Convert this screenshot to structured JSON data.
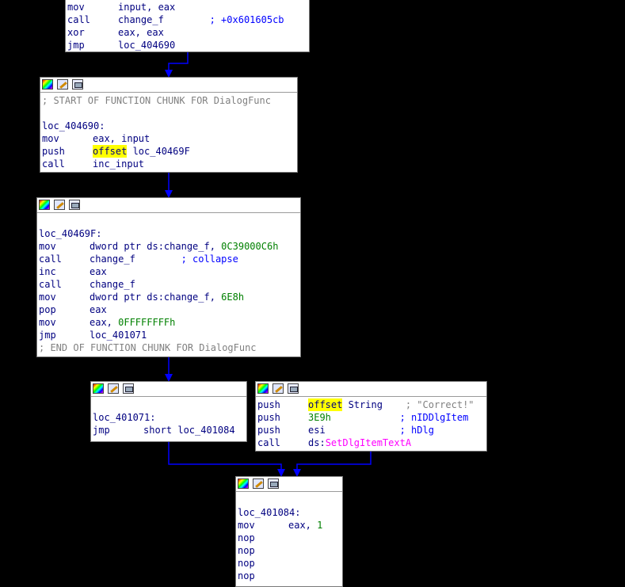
{
  "nodes": {
    "n1": {
      "lines": [
        {
          "m": "mov",
          "a": [
            {
              "t": "input, eax",
              "c": "op"
            }
          ]
        },
        {
          "m": "call",
          "a": [
            {
              "t": "change_f",
              "c": "op"
            },
            {
              "t": "        ; +0x601605cb",
              "c": "cm"
            }
          ]
        },
        {
          "m": "xor",
          "a": [
            {
              "t": "eax, eax",
              "c": "op"
            }
          ]
        },
        {
          "m": "jmp",
          "a": [
            {
              "t": "loc_404690",
              "c": "op"
            }
          ]
        }
      ]
    },
    "n2": {
      "lines": [
        {
          "raw": [
            {
              "t": "; START OF FUNCTION CHUNK FOR DialogFunc",
              "c": "gr"
            }
          ]
        },
        {
          "raw": []
        },
        {
          "raw": [
            {
              "t": "loc_404690:",
              "c": "lbl"
            }
          ]
        },
        {
          "m": "mov",
          "a": [
            {
              "t": "eax, input",
              "c": "op"
            }
          ]
        },
        {
          "m": "push",
          "a": [
            {
              "t": "offset",
              "c": "hl"
            },
            {
              "t": " loc_40469F",
              "c": "op"
            }
          ]
        },
        {
          "m": "call",
          "a": [
            {
              "t": "inc_input",
              "c": "op"
            }
          ]
        }
      ]
    },
    "n3": {
      "lines": [
        {
          "raw": []
        },
        {
          "raw": [
            {
              "t": "loc_40469F:",
              "c": "lbl"
            }
          ]
        },
        {
          "m": "mov",
          "a": [
            {
              "t": "dword ptr ds:change_f, ",
              "c": "op"
            },
            {
              "t": "0C39000C6h",
              "c": "num"
            }
          ]
        },
        {
          "m": "call",
          "a": [
            {
              "t": "change_f",
              "c": "op"
            },
            {
              "t": "        ; collapse",
              "c": "cm"
            }
          ]
        },
        {
          "m": "inc",
          "a": [
            {
              "t": "eax",
              "c": "op"
            }
          ]
        },
        {
          "m": "call",
          "a": [
            {
              "t": "change_f",
              "c": "op"
            }
          ]
        },
        {
          "m": "mov",
          "a": [
            {
              "t": "dword ptr ds:change_f, ",
              "c": "op"
            },
            {
              "t": "6E8h",
              "c": "num"
            }
          ]
        },
        {
          "m": "pop",
          "a": [
            {
              "t": "eax",
              "c": "op"
            }
          ]
        },
        {
          "m": "mov",
          "a": [
            {
              "t": "eax, ",
              "c": "op"
            },
            {
              "t": "0FFFFFFFFh",
              "c": "num"
            }
          ]
        },
        {
          "m": "jmp",
          "a": [
            {
              "t": "loc_401071",
              "c": "op"
            }
          ]
        },
        {
          "raw": [
            {
              "t": "; END OF FUNCTION CHUNK FOR DialogFunc",
              "c": "gr"
            }
          ]
        }
      ]
    },
    "n4": {
      "lines": [
        {
          "raw": []
        },
        {
          "raw": [
            {
              "t": "loc_401071:",
              "c": "lbl"
            }
          ]
        },
        {
          "m": "jmp",
          "a": [
            {
              "t": "short loc_401084",
              "c": "op"
            }
          ]
        }
      ]
    },
    "n5": {
      "lines": [
        {
          "m": "push",
          "a": [
            {
              "t": "offset",
              "c": "hl"
            },
            {
              "t": " String",
              "c": "op"
            },
            {
              "t": "    ; \"Correct!\"",
              "c": "gr"
            }
          ]
        },
        {
          "m": "push",
          "a": [
            {
              "t": "3E9h",
              "c": "num"
            },
            {
              "t": "            ; nIDDlgItem",
              "c": "cm"
            }
          ]
        },
        {
          "m": "push",
          "a": [
            {
              "t": "esi",
              "c": "op"
            },
            {
              "t": "             ; hDlg",
              "c": "cm"
            }
          ]
        },
        {
          "m": "call",
          "a": [
            {
              "t": "ds:",
              "c": "op"
            },
            {
              "t": "SetDlgItemTextA",
              "c": "imp"
            }
          ]
        }
      ]
    },
    "n6": {
      "lines": [
        {
          "raw": []
        },
        {
          "raw": [
            {
              "t": "loc_401084:",
              "c": "lbl"
            }
          ]
        },
        {
          "m": "mov",
          "a": [
            {
              "t": "eax, ",
              "c": "op"
            },
            {
              "t": "1",
              "c": "num"
            }
          ]
        },
        {
          "m": "nop",
          "a": []
        },
        {
          "m": "nop",
          "a": []
        },
        {
          "m": "nop",
          "a": []
        },
        {
          "m": "nop",
          "a": []
        }
      ]
    }
  },
  "icons": [
    "color-palette-icon",
    "edit-pencil-icon",
    "graph-view-icon"
  ],
  "colors": {
    "edge": "#0000ff",
    "highlight": "#ffff00",
    "import": "#ff00ff",
    "number": "#008000"
  }
}
